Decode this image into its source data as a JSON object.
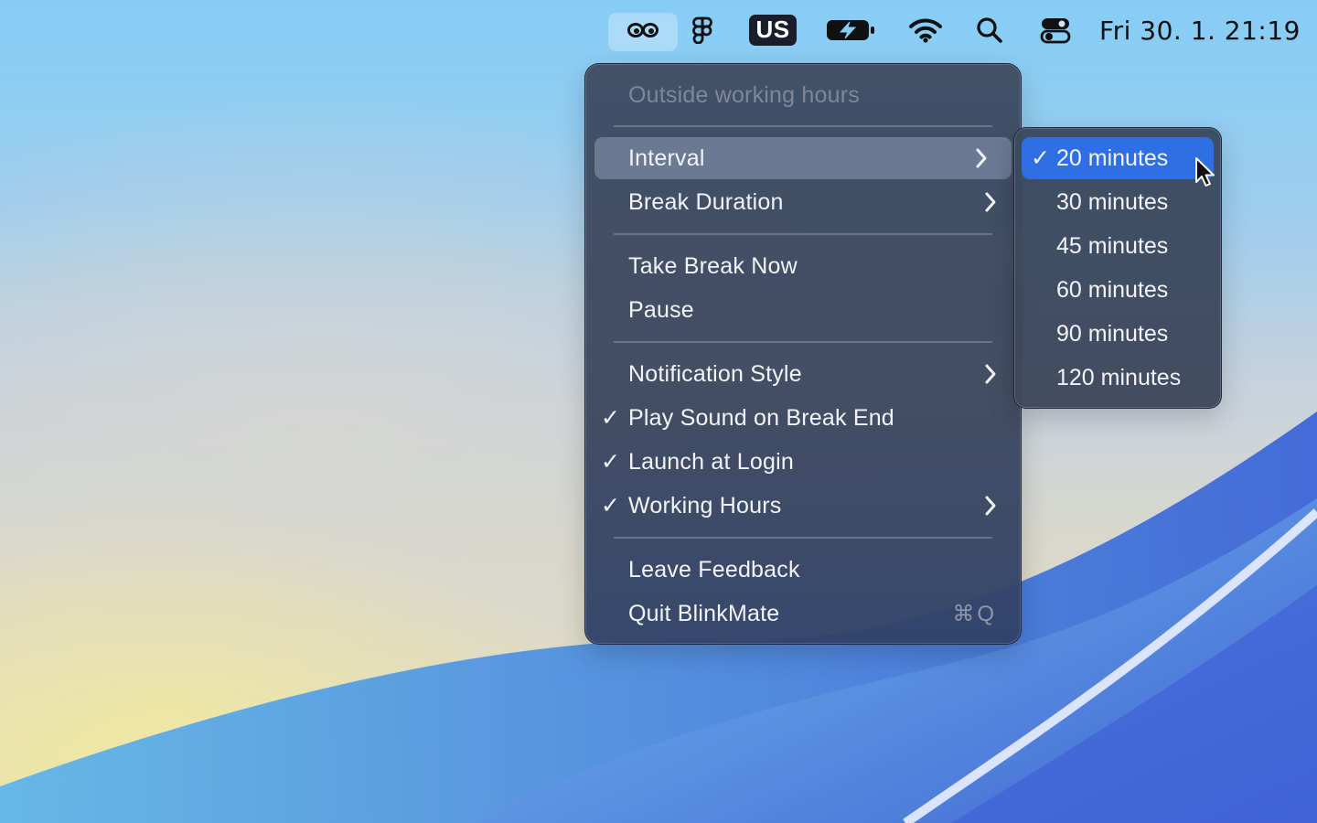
{
  "menubar": {
    "keyboard_layout": "US",
    "datetime": "Fri 30. 1.  21:19",
    "icons": [
      "blinkmate-eyes-icon",
      "figma-icon",
      "battery-charging-icon",
      "wifi-icon",
      "search-icon",
      "control-center-icon"
    ]
  },
  "menu": {
    "header": "Outside working hours",
    "items": [
      {
        "label": "Interval",
        "checked": false,
        "submenu": true,
        "highlighted": true
      },
      {
        "label": "Break Duration",
        "checked": false,
        "submenu": true
      },
      {
        "label": "Take Break Now",
        "checked": false
      },
      {
        "label": "Pause",
        "checked": false
      },
      {
        "label": "Notification Style",
        "checked": false,
        "submenu": true
      },
      {
        "label": "Play Sound on Break End",
        "checked": true
      },
      {
        "label": "Launch at Login",
        "checked": true
      },
      {
        "label": "Working Hours",
        "checked": true,
        "submenu": true
      },
      {
        "label": "Leave Feedback",
        "checked": false
      },
      {
        "label": "Quit BlinkMate",
        "checked": false,
        "shortcut": "⌘Q"
      }
    ],
    "check_glyph": "✓"
  },
  "interval_submenu": {
    "options": [
      "20 minutes",
      "30 minutes",
      "45 minutes",
      "60 minutes",
      "90 minutes",
      "120 minutes"
    ],
    "selected": "20 minutes"
  },
  "colors": {
    "selection": "#2f6fe6",
    "menu_text": "#f1f3f7"
  }
}
